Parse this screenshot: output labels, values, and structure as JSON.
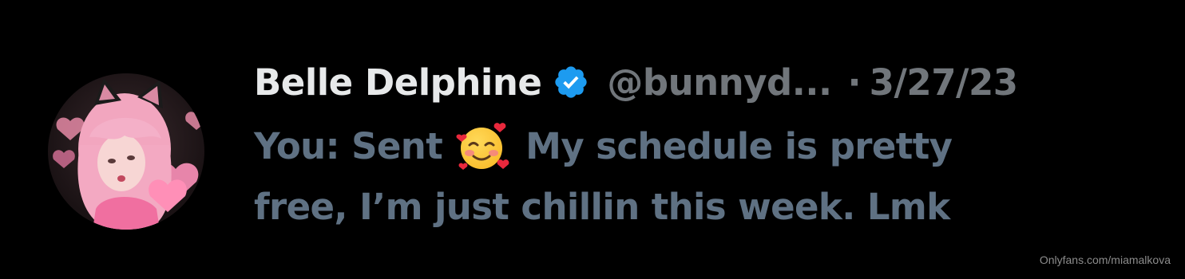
{
  "tweet": {
    "display_name": "Belle Delphine",
    "verified_icon": "verified-badge-icon",
    "handle": "@bunnyd...",
    "separator": "·",
    "date": "3/27/23",
    "message_prefix": "You: Sent",
    "emoji_icon": "smiling-face-with-hearts-icon",
    "message_line1_rest": "My schedule is pretty",
    "message_line2": "free, I’m just chillin this week. Lmk"
  },
  "watermark": "Onlyfans.com/miamalkova",
  "colors": {
    "background": "#000000",
    "name": "#e7e9ea",
    "muted": "#71767b",
    "message": "#5f7183",
    "verified": "#1d9bf0"
  }
}
